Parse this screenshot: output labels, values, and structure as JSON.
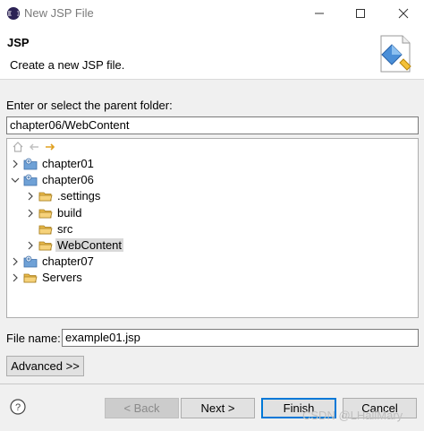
{
  "window": {
    "title": "New JSP File"
  },
  "header": {
    "title": "JSP",
    "description": "Create a new JSP file."
  },
  "folder": {
    "label": "Enter or select the parent folder:",
    "value": "chapter06/WebContent"
  },
  "tree": {
    "items": [
      {
        "label": "chapter01",
        "type": "project",
        "expanded": false
      },
      {
        "label": "chapter06",
        "type": "project",
        "expanded": true
      },
      {
        "label": ".settings",
        "type": "folder",
        "expanded": false
      },
      {
        "label": "build",
        "type": "folder",
        "expanded": false
      },
      {
        "label": "src",
        "type": "folder",
        "expanded": false
      },
      {
        "label": "WebContent",
        "type": "folder",
        "expanded": false,
        "selected": true
      },
      {
        "label": "chapter07",
        "type": "project",
        "expanded": false
      },
      {
        "label": "Servers",
        "type": "folder",
        "expanded": false
      }
    ]
  },
  "filename": {
    "label": "File name:",
    "value": "example01.jsp"
  },
  "buttons": {
    "advanced": "Advanced >>",
    "back": "< Back",
    "next": "Next >",
    "finish": "Finish",
    "cancel": "Cancel"
  },
  "watermark": "CSDN @LHallMary",
  "colors": {
    "folder": "#e8b84a",
    "selection": "#d9d9d9",
    "default_button_border": "#0078d7"
  }
}
